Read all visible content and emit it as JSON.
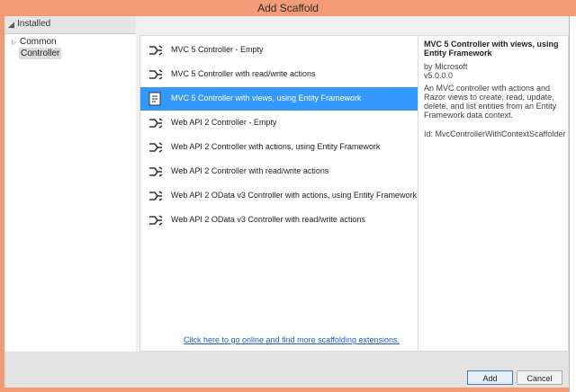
{
  "window": {
    "title": "Add Scaffold"
  },
  "left": {
    "header": "Installed",
    "tree": [
      {
        "label": "Common"
      },
      {
        "label": "Controller"
      }
    ]
  },
  "list": {
    "items": [
      {
        "label": "MVC 5 Controller - Empty"
      },
      {
        "label": "MVC 5 Controller with read/write actions"
      },
      {
        "label": "MVC 5 Controller with views, using Entity Framework"
      },
      {
        "label": "Web API 2 Controller - Empty"
      },
      {
        "label": "Web API 2 Controller with actions, using Entity Framework"
      },
      {
        "label": "Web API 2 Controller with read/write actions"
      },
      {
        "label": "Web API 2 OData v3 Controller with actions, using Entity Framework"
      },
      {
        "label": "Web API 2 OData v3 Controller with read/write actions"
      }
    ],
    "selected_index": 2,
    "online_link": "Click here to go online and find more scaffolding extensions."
  },
  "details": {
    "title": "MVC 5 Controller with views, using Entity Framework",
    "by": "by Microsoft",
    "version": "v5.0.0.0",
    "description": "An MVC controller with actions and Razor views to create, read, update, delete, and list entities from an Entity Framework data context.",
    "id": "Id: MvcControllerWithContextScaffolder"
  },
  "buttons": {
    "add": "Add",
    "cancel": "Cancel"
  },
  "colors": {
    "titlebar": "#f29b76",
    "selection": "#3399ff",
    "link": "#1a5fd0"
  }
}
